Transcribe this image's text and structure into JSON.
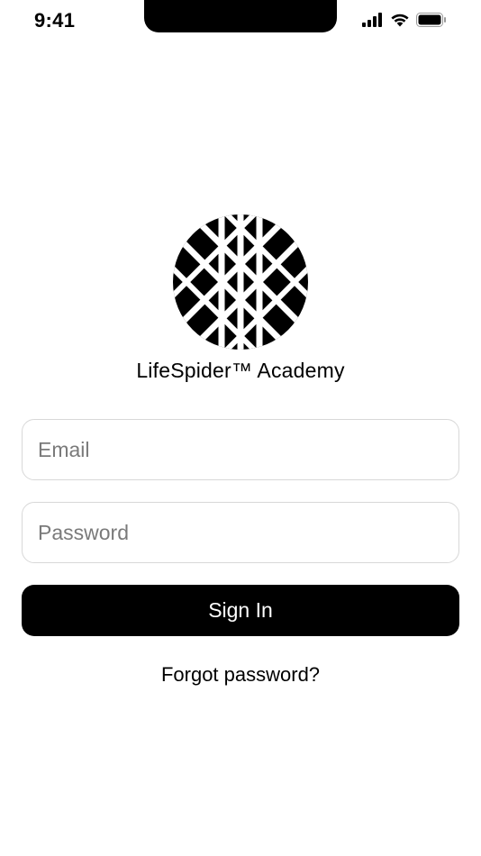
{
  "status_bar": {
    "time": "9:41",
    "signal_icon": "cellular-signal-icon",
    "wifi_icon": "wifi-icon",
    "battery_icon": "battery-icon"
  },
  "brand": {
    "logo_icon": "lifespider-logo",
    "name": "LifeSpider™ Academy"
  },
  "form": {
    "email_placeholder": "Email",
    "email_value": "",
    "password_placeholder": "Password",
    "password_value": "",
    "sign_in_label": "Sign In",
    "forgot_password_label": "Forgot password?"
  },
  "colors": {
    "primary": "#000000",
    "background": "#ffffff",
    "input_border": "#d8d8d8",
    "placeholder": "#7a7a7a"
  }
}
